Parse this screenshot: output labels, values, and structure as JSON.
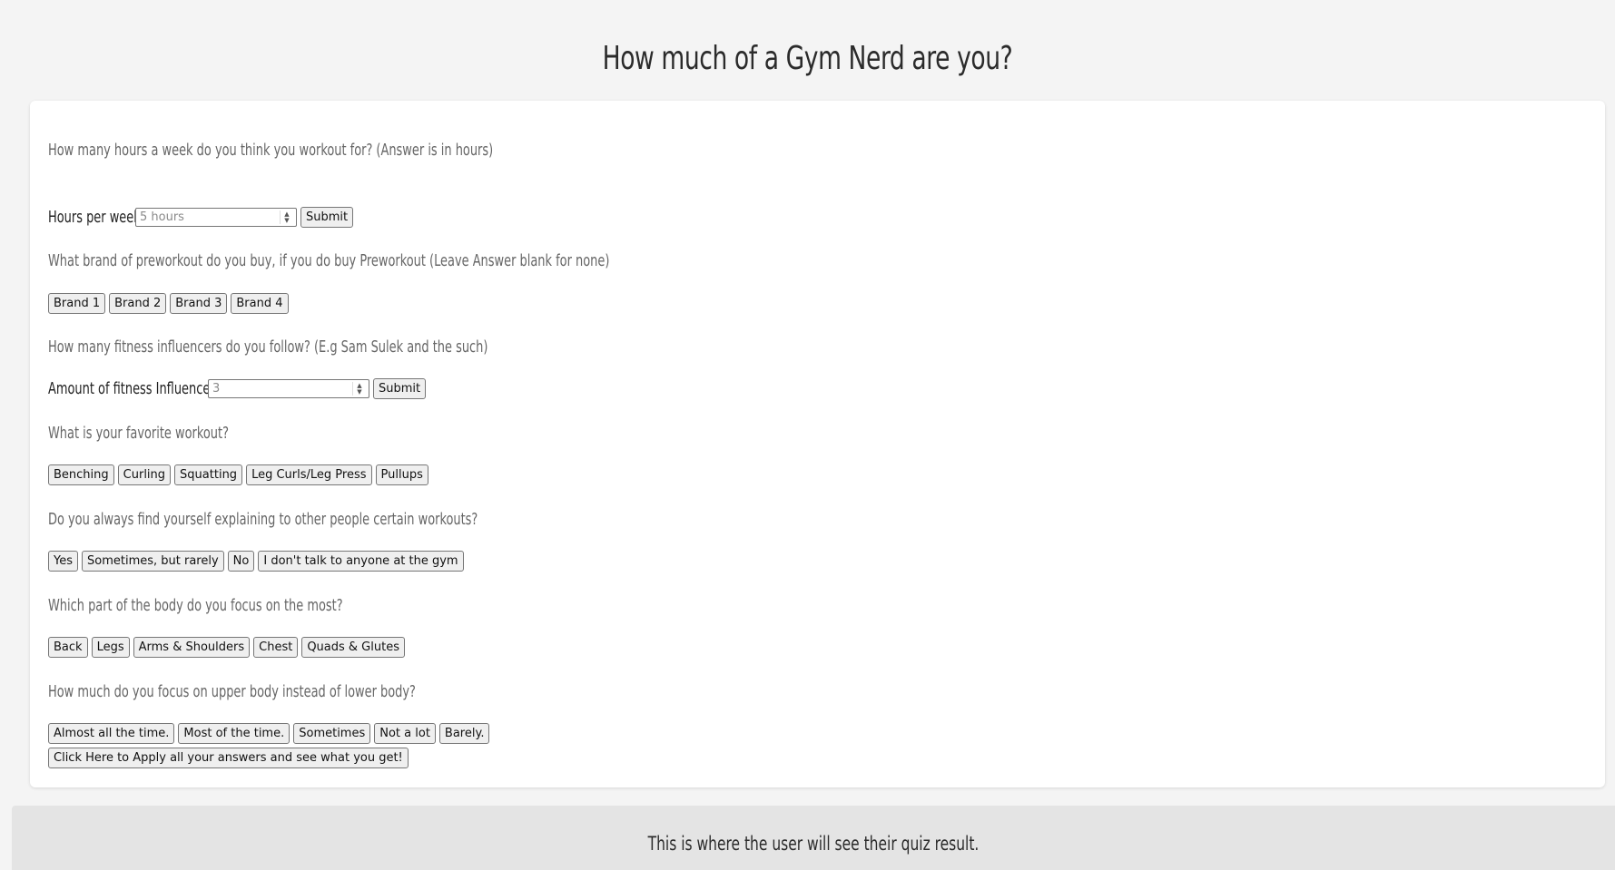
{
  "title": "How much of a Gym Nerd are you?",
  "q1": {
    "question": "How many hours a week do you think you workout for? (Answer is in hours)",
    "label": "Hours per week",
    "placeholder": "5 hours",
    "submit": "Submit"
  },
  "q2": {
    "question": "What brand of preworkout do you buy, if you do buy Preworkout (Leave Answer blank for none)",
    "options": [
      "Brand 1",
      "Brand 2",
      "Brand 3",
      "Brand 4"
    ]
  },
  "q3": {
    "question": "How many fitness influencers do you follow? (E.g Sam Sulek and the such)",
    "label": "Amount of fitness Influencers",
    "placeholder": "3",
    "submit": "Submit"
  },
  "q4": {
    "question": "What is your favorite workout?",
    "options": [
      "Benching",
      "Curling",
      "Squatting",
      "Leg Curls/Leg Press",
      "Pullups"
    ]
  },
  "q5": {
    "question": "Do you always find yourself explaining to other people certain workouts?",
    "options": [
      "Yes",
      "Sometimes, but rarely",
      "No",
      "I don't talk to anyone at the gym"
    ]
  },
  "q6": {
    "question": "Which part of the body do you focus on the most?",
    "options": [
      "Back",
      "Legs",
      "Arms & Shoulders",
      "Chest",
      "Quads & Glutes"
    ]
  },
  "q7": {
    "question": "How much do you focus on upper body instead of lower body?",
    "options": [
      "Almost all the time.",
      "Most of the time.",
      "Sometimes",
      "Not a lot",
      "Barely."
    ]
  },
  "apply_button": "Click Here to Apply all your answers and see what you get!",
  "result": "This is where the user will see their quiz result."
}
